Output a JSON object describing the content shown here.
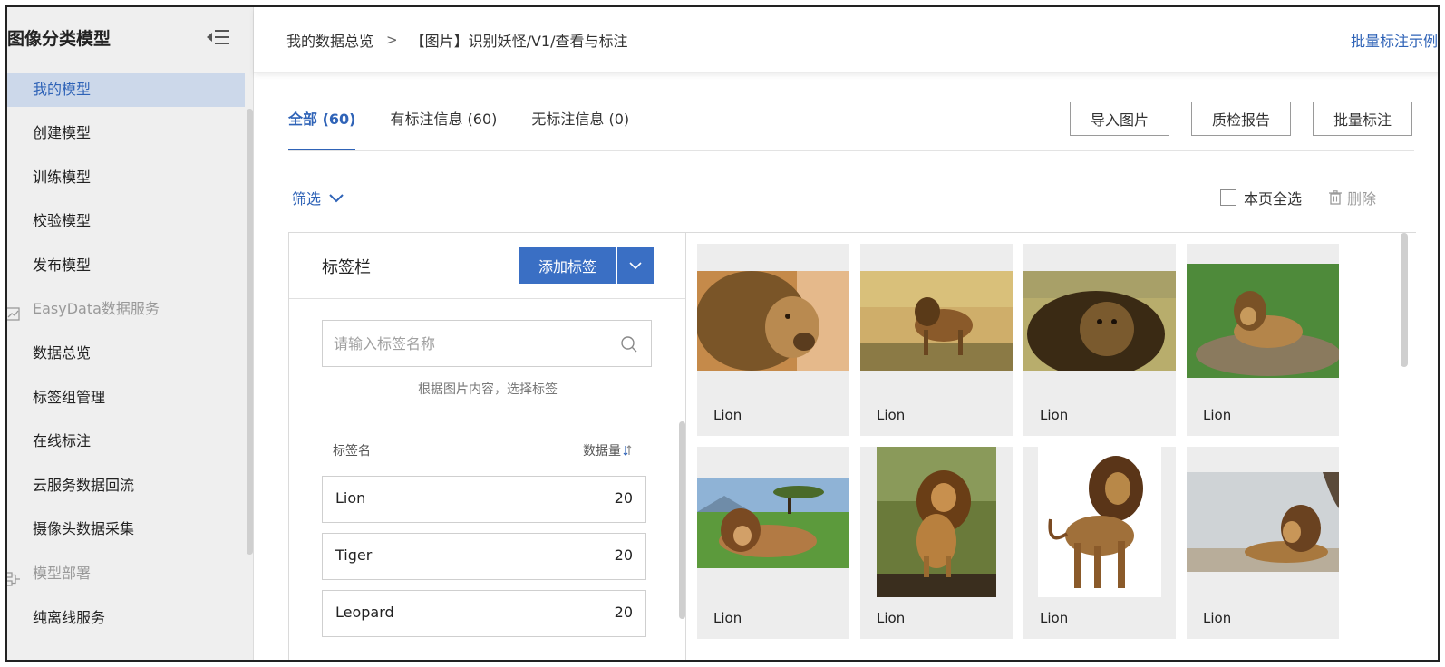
{
  "sidebar": {
    "title": "图像分类模型",
    "items": [
      {
        "label": "我的模型",
        "active": true
      },
      {
        "label": "创建模型"
      },
      {
        "label": "训练模型"
      },
      {
        "label": "校验模型"
      },
      {
        "label": "发布模型"
      }
    ],
    "group_easydata": {
      "label": "EasyData数据服务",
      "icon": "chart-icon"
    },
    "easydata_items": [
      {
        "label": "数据总览"
      },
      {
        "label": "标签组管理"
      },
      {
        "label": "在线标注"
      },
      {
        "label": "云服务数据回流"
      },
      {
        "label": "摄像头数据采集"
      }
    ],
    "group_deploy": {
      "label": "模型部署",
      "icon": "deploy-icon"
    },
    "deploy_items": [
      {
        "label": "纯离线服务"
      }
    ]
  },
  "header": {
    "breadcrumb_root": "我的数据总览",
    "breadcrumb_sep": ">",
    "breadcrumb_current": "【图片】识别妖怪/V1/查看与标注",
    "batch_example": "批量标注示例"
  },
  "tabs": [
    {
      "label": "全部 (60)",
      "active": true
    },
    {
      "label": "有标注信息 (60)"
    },
    {
      "label": "无标注信息 (0)"
    }
  ],
  "actions": {
    "import": "导入图片",
    "quality": "质检报告",
    "batch": "批量标注"
  },
  "filter": {
    "label": "筛选",
    "select_all": "本页全选",
    "delete": "删除"
  },
  "label_panel": {
    "title": "标签栏",
    "add_button": "添加标签",
    "search_placeholder": "请输入标签名称",
    "hint": "根据图片内容，选择标签",
    "col_name": "标签名",
    "col_count": "数据量",
    "tags": [
      {
        "name": "Lion",
        "count": "20"
      },
      {
        "name": "Tiger",
        "count": "20"
      },
      {
        "name": "Leopard",
        "count": "20"
      }
    ]
  },
  "images": [
    {
      "label": "Lion"
    },
    {
      "label": "Lion"
    },
    {
      "label": "Lion"
    },
    {
      "label": "Lion"
    },
    {
      "label": "Lion"
    },
    {
      "label": "Lion"
    },
    {
      "label": "Lion"
    },
    {
      "label": "Lion"
    }
  ],
  "colors": {
    "accent": "#2f63b7",
    "button_primary": "#3a6fc4",
    "sidebar_bg": "#efefef",
    "active_bg": "#ccd8ea"
  }
}
